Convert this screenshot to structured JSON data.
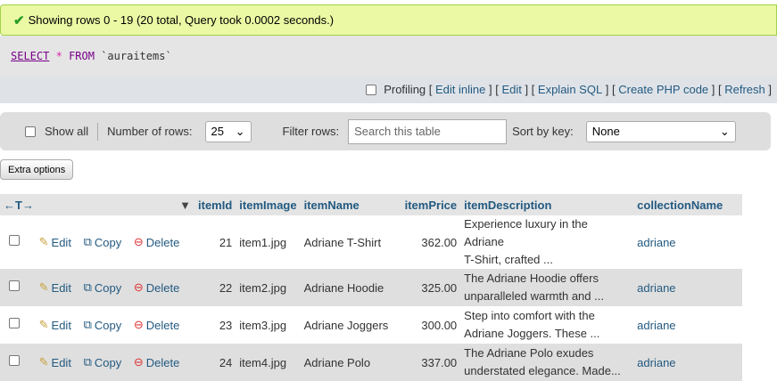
{
  "message": "Showing rows 0 - 19 (20 total, Query took 0.0002 seconds.)",
  "sql": {
    "select": "SELECT",
    "star": "*",
    "from": "FROM",
    "table": "`auraitems`"
  },
  "toolbar": {
    "profiling": "Profiling",
    "edit_inline": "Edit inline",
    "edit": "Edit",
    "explain": "Explain SQL",
    "php": "Create PHP code",
    "refresh": "Refresh"
  },
  "nav": {
    "show_all": "Show all",
    "rows_label": "Number of rows:",
    "rows_value": "25",
    "filter_label": "Filter rows:",
    "filter_placeholder": "Search this table",
    "sort_label": "Sort by key:",
    "sort_value": "None"
  },
  "extra_options": "Extra options",
  "columns": [
    "itemId",
    "itemImage",
    "itemName",
    "itemPrice",
    "itemDescription",
    "collectionName"
  ],
  "actions": {
    "edit": "Edit",
    "copy": "Copy",
    "delete": "Delete"
  },
  "rows": [
    {
      "id": "21",
      "image": "item1.jpg",
      "name": "Adriane T-Shirt",
      "price": "362.00",
      "desc1": "Experience luxury in the Adriane",
      "desc2": "T-Shirt, crafted ...",
      "collection": "adriane"
    },
    {
      "id": "22",
      "image": "item2.jpg",
      "name": "Adriane Hoodie",
      "price": "325.00",
      "desc1": "The Adriane Hoodie offers",
      "desc2": "unparalleled warmth and ...",
      "collection": "adriane"
    },
    {
      "id": "23",
      "image": "item3.jpg",
      "name": "Adriane Joggers",
      "price": "300.00",
      "desc1": "Step into comfort with the",
      "desc2": "Adriane Joggers. These ...",
      "collection": "adriane"
    },
    {
      "id": "24",
      "image": "item4.jpg",
      "name": "Adriane Polo",
      "price": "337.00",
      "desc1": "The Adriane Polo exudes",
      "desc2": "understated elegance. Made...",
      "collection": "adriane"
    }
  ]
}
